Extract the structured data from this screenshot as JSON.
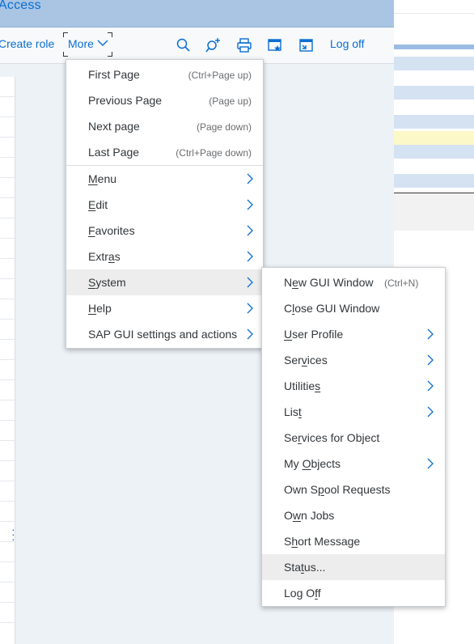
{
  "window": {
    "title": "Access"
  },
  "toolbar": {
    "create_role": "Create role",
    "more_label": "More",
    "log_off": "Log off",
    "icons": [
      "search-icon",
      "find-next-icon",
      "print-icon",
      "new-window-icon",
      "shortcut-icon"
    ]
  },
  "more_menu": {
    "items": [
      {
        "label": "First Page",
        "shortcut": "(Ctrl+Page up)"
      },
      {
        "label": "Previous Page",
        "shortcut": "(Page up)"
      },
      {
        "label": "Next page",
        "shortcut": "(Page down)"
      },
      {
        "label": "Last Page",
        "shortcut": "(Ctrl+Page down)"
      },
      {
        "pre": "",
        "u": "M",
        "post": "enu",
        "submenu": true
      },
      {
        "pre": "",
        "u": "E",
        "post": "dit",
        "submenu": true
      },
      {
        "pre": "",
        "u": "F",
        "post": "avorites",
        "submenu": true
      },
      {
        "pre": "Extr",
        "u": "a",
        "post": "s",
        "submenu": true
      },
      {
        "pre": "",
        "u": "S",
        "post": "ystem",
        "submenu": true
      },
      {
        "pre": "",
        "u": "H",
        "post": "elp",
        "submenu": true
      },
      {
        "label": "SAP GUI settings and actions",
        "submenu": true
      }
    ]
  },
  "system_menu": {
    "items": [
      {
        "pre": "N",
        "u": "e",
        "post": "w GUI Window",
        "shortcut": "(Ctrl+N)"
      },
      {
        "pre": "C",
        "u": "l",
        "post": "ose GUI Window"
      },
      {
        "pre": "",
        "u": "U",
        "post": "ser Profile",
        "submenu": true
      },
      {
        "pre": "Ser",
        "u": "v",
        "post": "ices",
        "submenu": true
      },
      {
        "pre": "Utilitie",
        "u": "s",
        "post": "",
        "submenu": true
      },
      {
        "pre": "Lis",
        "u": "t",
        "post": "",
        "submenu": true
      },
      {
        "pre": "Se",
        "u": "r",
        "post": "vices for Object"
      },
      {
        "pre": "My ",
        "u": "O",
        "post": "bjects",
        "submenu": true
      },
      {
        "pre": "Own S",
        "u": "p",
        "post": "ool Requests"
      },
      {
        "pre": "O",
        "u": "w",
        "post": "n Jobs"
      },
      {
        "pre": "S",
        "u": "h",
        "post": "ort Message"
      },
      {
        "pre": "Sta",
        "u": "t",
        "post": "us..."
      },
      {
        "pre": "Log O",
        "u": "f",
        "post": "f"
      }
    ]
  },
  "colors": {
    "accent": "#0a6ed1",
    "title_bar": "#a9c5e3",
    "highlight": "#ededed",
    "row_blue": "#d5e2f2",
    "row_yellow": "#fdf8c8"
  }
}
